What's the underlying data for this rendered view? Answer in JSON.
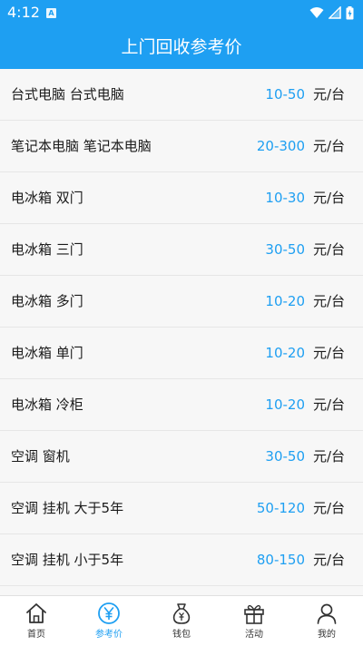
{
  "colors": {
    "accent": "#1e9ff2",
    "text": "#1a1a1a",
    "background": "#f7f7f7"
  },
  "status_bar": {
    "time": "4:12",
    "notification_icon": "a-icon",
    "notification_letter": "A",
    "icons": [
      "wifi-icon",
      "signal-icon",
      "battery-charging-icon"
    ]
  },
  "header": {
    "title": "上门回收参考价"
  },
  "price_list": {
    "items": [
      {
        "name": "台式电脑 台式电脑",
        "price": "10-50",
        "unit": "元/台"
      },
      {
        "name": "笔记本电脑 笔记本电脑",
        "price": "20-300",
        "unit": "元/台"
      },
      {
        "name": "电冰箱 双门",
        "price": "10-30",
        "unit": "元/台"
      },
      {
        "name": "电冰箱 三门",
        "price": "30-50",
        "unit": "元/台"
      },
      {
        "name": "电冰箱 多门",
        "price": "10-20",
        "unit": "元/台"
      },
      {
        "name": "电冰箱 单门",
        "price": "10-20",
        "unit": "元/台"
      },
      {
        "name": "电冰箱 冷柜",
        "price": "10-20",
        "unit": "元/台"
      },
      {
        "name": "空调 窗机",
        "price": "30-50",
        "unit": "元/台"
      },
      {
        "name": "空调 挂机 大于5年",
        "price": "50-120",
        "unit": "元/台"
      },
      {
        "name": "空调 挂机 小于5年",
        "price": "80-150",
        "unit": "元/台"
      }
    ]
  },
  "bottom_nav": {
    "items": [
      {
        "label": "首页",
        "icon": "home-icon",
        "active": false
      },
      {
        "label": "参考价",
        "icon": "yen-circle-icon",
        "active": true
      },
      {
        "label": "钱包",
        "icon": "money-bag-icon",
        "active": false
      },
      {
        "label": "活动",
        "icon": "gift-icon",
        "active": false
      },
      {
        "label": "我的",
        "icon": "person-icon",
        "active": false
      }
    ]
  }
}
